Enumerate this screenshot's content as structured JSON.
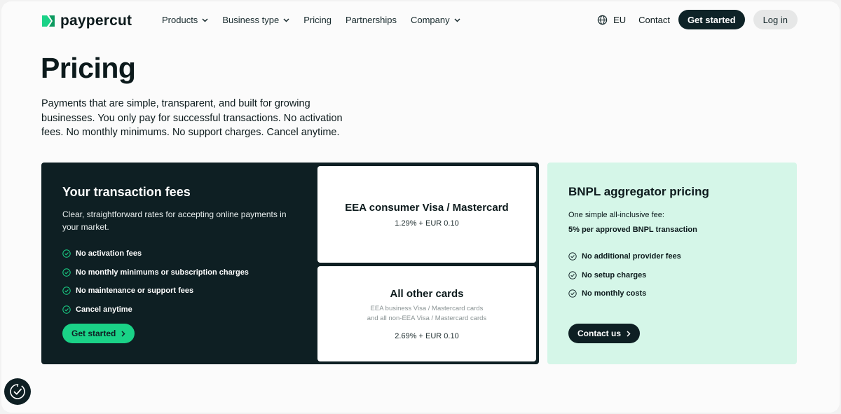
{
  "nav": {
    "logo_text": "paypercut",
    "menu": [
      {
        "label": "Products",
        "dropdown": true
      },
      {
        "label": "Business type",
        "dropdown": true
      },
      {
        "label": "Pricing",
        "dropdown": false
      },
      {
        "label": "Partnerships",
        "dropdown": false
      },
      {
        "label": "Company",
        "dropdown": true
      }
    ],
    "region": "EU",
    "contact": "Contact",
    "get_started": "Get started",
    "login": "Log in"
  },
  "hero": {
    "title": "Pricing",
    "intro": "Payments that are simple, transparent, and built for growing businesses. You only pay for successful transactions. No activation fees. No monthly minimums. No support charges. Cancel anytime."
  },
  "fees_card": {
    "title": "Your transaction fees",
    "subtitle": "Clear, straightforward rates for accepting online payments in your market.",
    "features": [
      "No activation fees",
      "No monthly minimums or subscription charges",
      "No maintenance or support fees",
      "Cancel anytime"
    ],
    "cta": "Get started",
    "rates": [
      {
        "name": "EEA consumer Visa / Mastercard",
        "note": "",
        "value": "1.29% + EUR 0.10"
      },
      {
        "name": "All other cards",
        "note": "EEA business Visa / Mastercard cards and all non-EEA Visa / Mastercard cards",
        "value": "2.69% + EUR 0.10"
      }
    ]
  },
  "bnpl_card": {
    "title": "BNPL aggregator pricing",
    "subtitle": "One simple all-inclusive fee:",
    "fee": "5% per approved BNPL transaction",
    "features": [
      "No additional provider fees",
      "No setup charges",
      "No monthly costs"
    ],
    "cta": "Contact us"
  },
  "colors": {
    "dark": "#0e1f23",
    "accent_green": "#1ad287",
    "mint": "#d5f6e8",
    "page_bg": "#fbfbfb"
  },
  "icons": [
    "logo-icon",
    "chevron-down-icon",
    "globe-icon",
    "check-circle-icon",
    "chevron-right-icon",
    "cookie-consent-icon"
  ]
}
